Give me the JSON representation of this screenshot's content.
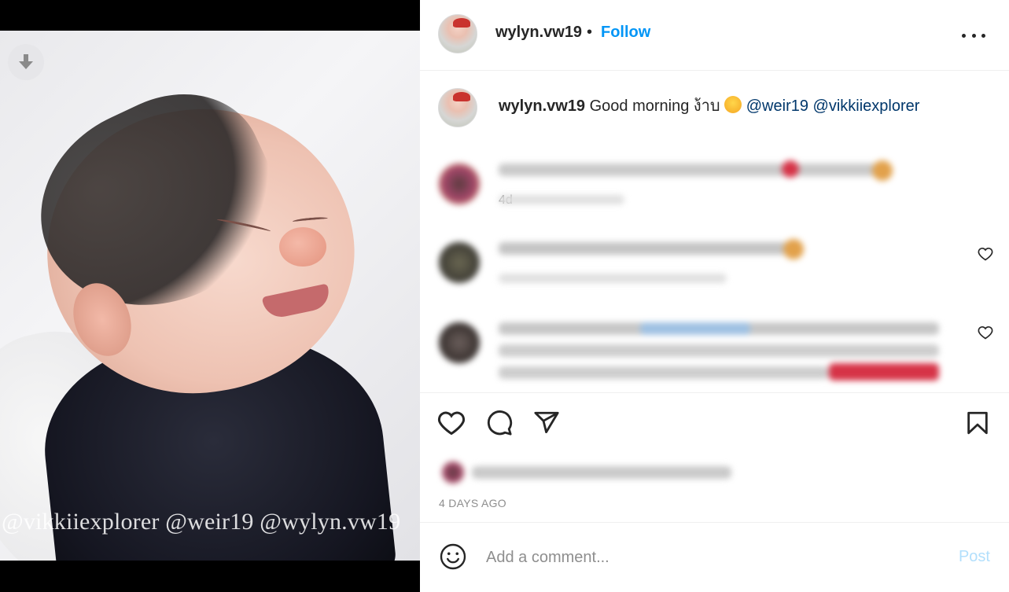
{
  "post": {
    "username": "wylyn.vw19",
    "follow_label": "Follow",
    "separator": "•",
    "more_icon": "more-icon",
    "caption_body": "Good morning ง้าบ",
    "caption_emoji": "smiling-face-with-hearts",
    "mentions": [
      "@weir19",
      "@vikkiiexplorer"
    ],
    "caption_age": "4d",
    "time_ago": "4 DAYS AGO"
  },
  "media": {
    "watermark": "@vikkiiexplorer @weir19 @wylyn.vw19",
    "download_icon": "download-icon"
  },
  "actions": {
    "like_icon": "heart-icon",
    "comment_icon": "comment-icon",
    "share_icon": "share-icon",
    "save_icon": "bookmark-icon"
  },
  "comment_box": {
    "placeholder": "Add a comment...",
    "post_label": "Post",
    "emoji_icon": "emoji-icon"
  },
  "colors": {
    "follow_blue": "#0095f6",
    "mention_blue": "#00376b",
    "post_disabled": "#b2dffc",
    "secondary_text": "#8e8e8e",
    "divider": "#efefef"
  }
}
